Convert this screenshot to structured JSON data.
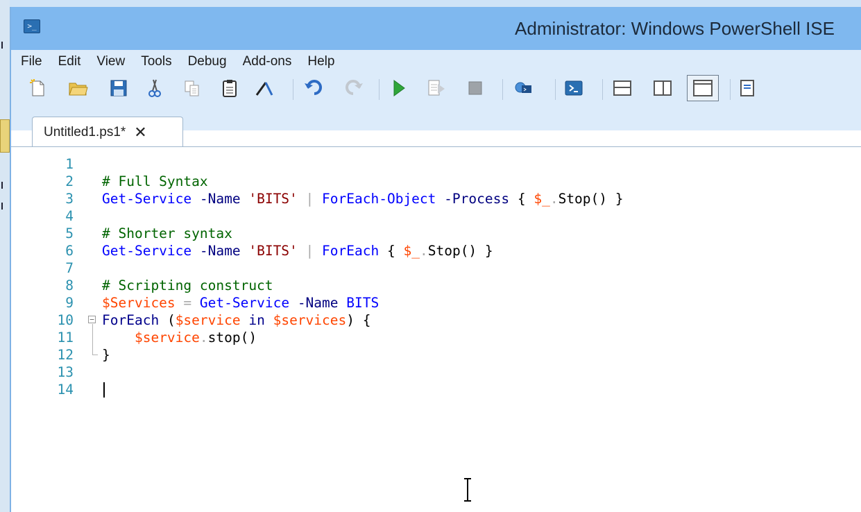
{
  "window": {
    "title": "Administrator: Windows PowerShell ISE",
    "app_icon": "powershell-icon"
  },
  "menu": [
    "File",
    "Edit",
    "View",
    "Tools",
    "Debug",
    "Add-ons",
    "Help"
  ],
  "toolbar": [
    {
      "name": "new-icon"
    },
    {
      "name": "open-icon"
    },
    {
      "name": "save-icon"
    },
    {
      "name": "cut-icon"
    },
    {
      "name": "copy-icon"
    },
    {
      "name": "paste-icon"
    },
    {
      "name": "clear-console-icon"
    },
    {
      "name": "undo-icon"
    },
    {
      "name": "redo-icon"
    },
    {
      "name": "run-script-icon"
    },
    {
      "name": "run-selection-icon"
    },
    {
      "name": "stop-icon"
    },
    {
      "name": "remote-powershell-icon"
    },
    {
      "name": "start-powershell-icon"
    },
    {
      "name": "show-script-pane-top-icon"
    },
    {
      "name": "show-script-pane-right-icon"
    },
    {
      "name": "show-script-pane-maximized-icon"
    },
    {
      "name": "show-command-window-icon"
    }
  ],
  "tabs": [
    {
      "label": "Untitled1.ps1*",
      "close": "✕",
      "active": true
    }
  ],
  "editor": {
    "lines": [
      {
        "n": "1",
        "tokens": []
      },
      {
        "n": "2",
        "tokens": [
          {
            "t": "# Full Syntax",
            "c": "com"
          }
        ]
      },
      {
        "n": "3",
        "tokens": [
          {
            "t": "Get-Service",
            "c": "cmd"
          },
          {
            "t": " "
          },
          {
            "t": "-Name",
            "c": "par"
          },
          {
            "t": " "
          },
          {
            "t": "'BITS'",
            "c": "str"
          },
          {
            "t": " "
          },
          {
            "t": "|",
            "c": "op"
          },
          {
            "t": " "
          },
          {
            "t": "ForEach-Object",
            "c": "cmd"
          },
          {
            "t": " "
          },
          {
            "t": "-Process",
            "c": "par"
          },
          {
            "t": " "
          },
          {
            "t": "{",
            "c": "grp"
          },
          {
            "t": " "
          },
          {
            "t": "$_",
            "c": "var"
          },
          {
            "t": ".",
            "c": "op"
          },
          {
            "t": "Stop",
            "c": "mem"
          },
          {
            "t": "()",
            "c": "grp"
          },
          {
            "t": " "
          },
          {
            "t": "}",
            "c": "grp"
          }
        ]
      },
      {
        "n": "4",
        "tokens": []
      },
      {
        "n": "5",
        "tokens": [
          {
            "t": "# Shorter syntax",
            "c": "com"
          }
        ]
      },
      {
        "n": "6",
        "tokens": [
          {
            "t": "Get-Service",
            "c": "cmd"
          },
          {
            "t": " "
          },
          {
            "t": "-Name",
            "c": "par"
          },
          {
            "t": " "
          },
          {
            "t": "'BITS'",
            "c": "str"
          },
          {
            "t": " "
          },
          {
            "t": "|",
            "c": "op"
          },
          {
            "t": " "
          },
          {
            "t": "ForEach",
            "c": "cmd"
          },
          {
            "t": " "
          },
          {
            "t": "{",
            "c": "grp"
          },
          {
            "t": " "
          },
          {
            "t": "$_",
            "c": "var"
          },
          {
            "t": ".",
            "c": "op"
          },
          {
            "t": "Stop",
            "c": "mem"
          },
          {
            "t": "()",
            "c": "grp"
          },
          {
            "t": " "
          },
          {
            "t": "}",
            "c": "grp"
          }
        ]
      },
      {
        "n": "7",
        "tokens": []
      },
      {
        "n": "8",
        "tokens": [
          {
            "t": "# Scripting construct",
            "c": "com"
          }
        ]
      },
      {
        "n": "9",
        "tokens": [
          {
            "t": "$Services",
            "c": "var"
          },
          {
            "t": " "
          },
          {
            "t": "=",
            "c": "op"
          },
          {
            "t": " "
          },
          {
            "t": "Get-Service",
            "c": "cmd"
          },
          {
            "t": " "
          },
          {
            "t": "-Name",
            "c": "par"
          },
          {
            "t": " "
          },
          {
            "t": "BITS",
            "c": "cmd"
          }
        ]
      },
      {
        "n": "10",
        "fold": true,
        "tokens": [
          {
            "t": "ForEach",
            "c": "kw"
          },
          {
            "t": " "
          },
          {
            "t": "(",
            "c": "grp"
          },
          {
            "t": "$service",
            "c": "var"
          },
          {
            "t": " "
          },
          {
            "t": "in",
            "c": "kw"
          },
          {
            "t": " "
          },
          {
            "t": "$services",
            "c": "var"
          },
          {
            "t": ")",
            "c": "grp"
          },
          {
            "t": " "
          },
          {
            "t": "{",
            "c": "grp"
          }
        ]
      },
      {
        "n": "11",
        "tokens": [
          {
            "t": "    "
          },
          {
            "t": "$service",
            "c": "var"
          },
          {
            "t": ".",
            "c": "op"
          },
          {
            "t": "stop",
            "c": "mem"
          },
          {
            "t": "()",
            "c": "grp"
          }
        ]
      },
      {
        "n": "12",
        "tokens": [
          {
            "t": "}",
            "c": "grp"
          }
        ]
      },
      {
        "n": "13",
        "tokens": []
      },
      {
        "n": "14",
        "tokens": []
      }
    ],
    "caret_line": "14"
  }
}
